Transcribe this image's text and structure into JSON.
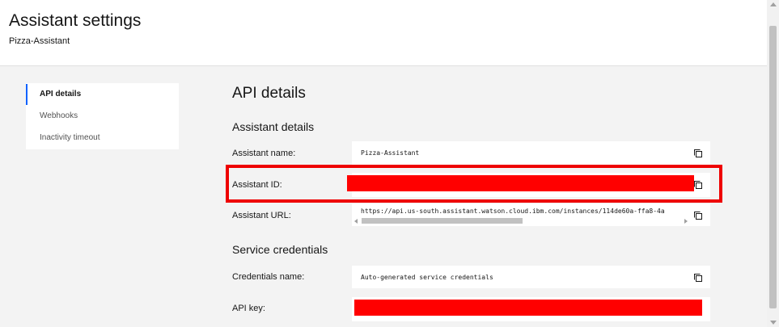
{
  "header": {
    "title": "Assistant settings",
    "subtitle": "Pizza-Assistant"
  },
  "sidenav": {
    "items": [
      {
        "label": "API details",
        "active": true
      },
      {
        "label": "Webhooks",
        "active": false
      },
      {
        "label": "Inactivity timeout",
        "active": false
      }
    ]
  },
  "main": {
    "title": "API details",
    "assistant_details": {
      "heading": "Assistant details",
      "name_label": "Assistant name:",
      "name_value": "Pizza-Assistant",
      "id_label": "Assistant ID:",
      "url_label": "Assistant URL:",
      "url_value": "https://api.us-south.assistant.watson.cloud.ibm.com/instances/114de60a-ffa8-4a"
    },
    "service_credentials": {
      "heading": "Service credentials",
      "credentials_label": "Credentials name:",
      "credentials_value": "Auto-generated service credentials",
      "api_key_label": "API key:"
    }
  },
  "icons": {
    "copy": "copy-icon"
  },
  "colors": {
    "redaction": "#ff0000",
    "highlight": "#ee0000",
    "active_nav": "#0f62fe"
  }
}
